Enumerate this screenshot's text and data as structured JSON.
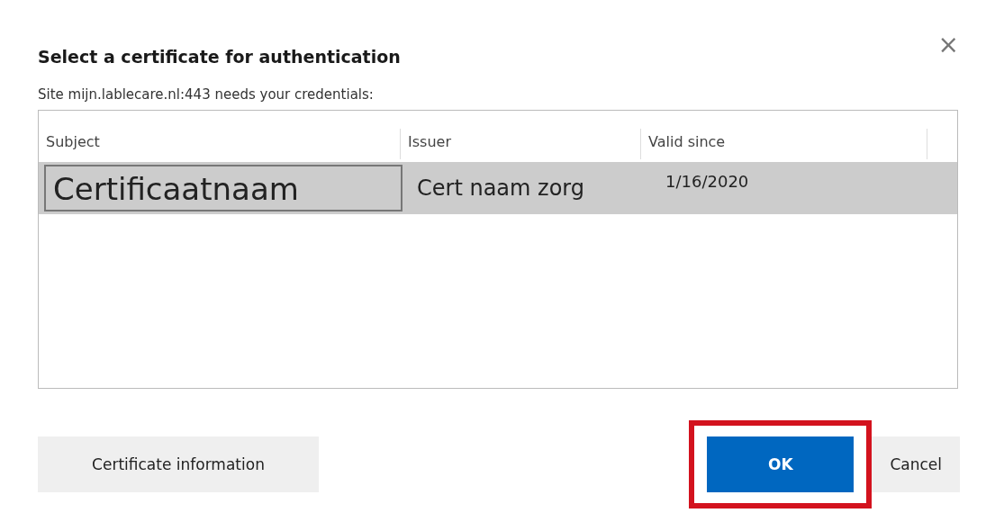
{
  "dialog": {
    "title": "Select a certificate for authentication",
    "close": "×",
    "message": "Site mijn.lablecare.nl:443 needs your credentials:"
  },
  "table": {
    "columns": [
      "Subject",
      "Issuer",
      "Valid since"
    ],
    "rows": [
      {
        "cells": [
          "Certificaatnaam",
          "Cert naam zorg",
          "1/16/2020"
        ],
        "selected": true
      }
    ]
  },
  "buttons": [
    {
      "label": "Certificate information",
      "kind": "secondary",
      "highlighted": false
    },
    {
      "label": "OK",
      "kind": "primary",
      "highlighted": true
    },
    {
      "label": "Cancel",
      "kind": "secondary",
      "highlighted": false
    }
  ]
}
